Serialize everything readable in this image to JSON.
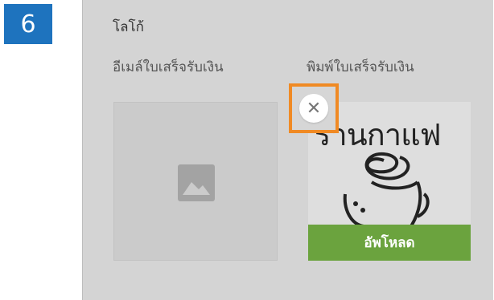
{
  "step": {
    "number": "6"
  },
  "section": {
    "title": "โลโก้"
  },
  "columns": {
    "email_receipt": "อีเมล์ใบเสร็จรับเงิน",
    "print_receipt": "พิมพ์ใบเสร็จรับเงิน"
  },
  "logo": {
    "text": "ร้านกาแฟ"
  },
  "actions": {
    "upload_label": "อัพโหลด",
    "remove_symbol": "✕"
  },
  "colors": {
    "step_badge": "#1e73be",
    "upload_button": "#6ba33e",
    "highlight": "#f08a24",
    "panel": "#d4d4d4"
  },
  "icons": {
    "placeholder": "image-placeholder-icon",
    "remove": "close-icon"
  }
}
